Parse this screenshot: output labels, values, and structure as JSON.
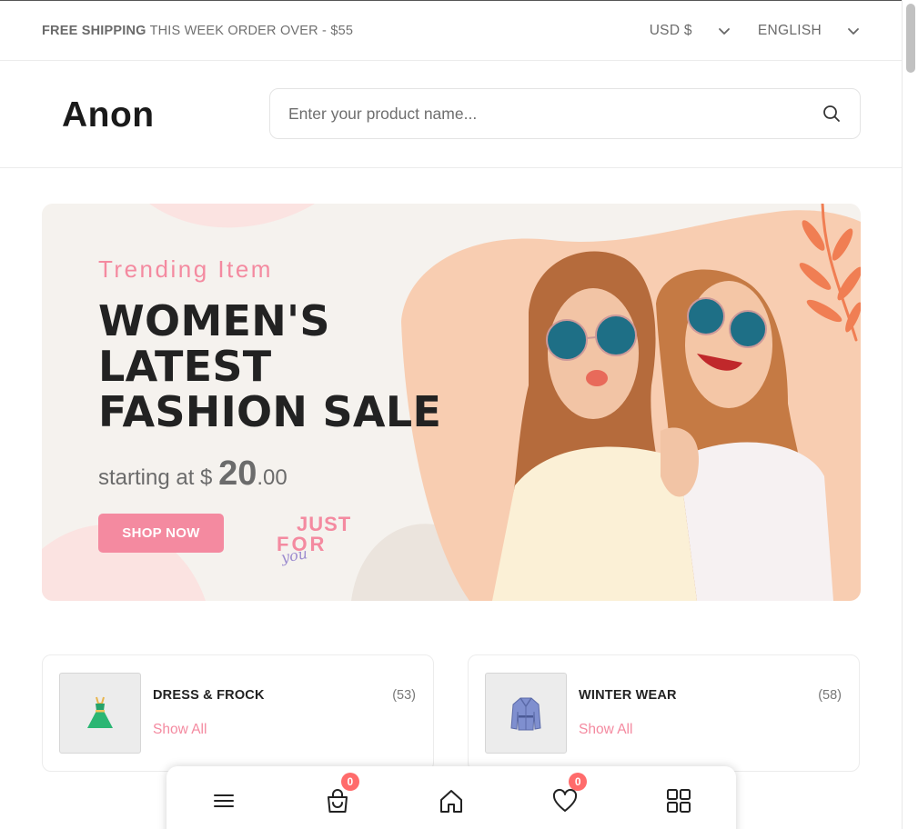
{
  "topbar": {
    "shipping_bold": "FREE SHIPPING",
    "shipping_text": "THIS WEEK ORDER OVER - $55",
    "currency": "USD $",
    "language": "ENGLISH"
  },
  "header": {
    "logo": "Anon",
    "search_placeholder": "Enter your product name..."
  },
  "banner": {
    "subtitle": "Trending Item",
    "title_line1": "WOMEN'S",
    "title_line2": "LATEST",
    "title_line3": "FASHION SALE",
    "price_prefix": "starting at $",
    "price_whole": "20",
    "price_cents": ".00",
    "cta": "SHOP NOW",
    "sticker": "JUST FOR you"
  },
  "categories": [
    {
      "name": "DRESS & FROCK",
      "count": "(53)",
      "link": "Show All"
    },
    {
      "name": "WINTER WEAR",
      "count": "(58)",
      "link": "Show All"
    }
  ],
  "bottom_nav": {
    "cart_count": "0",
    "wishlist_count": "0"
  },
  "colors": {
    "accent": "#f48aa0",
    "badge": "#ff6b6b"
  }
}
